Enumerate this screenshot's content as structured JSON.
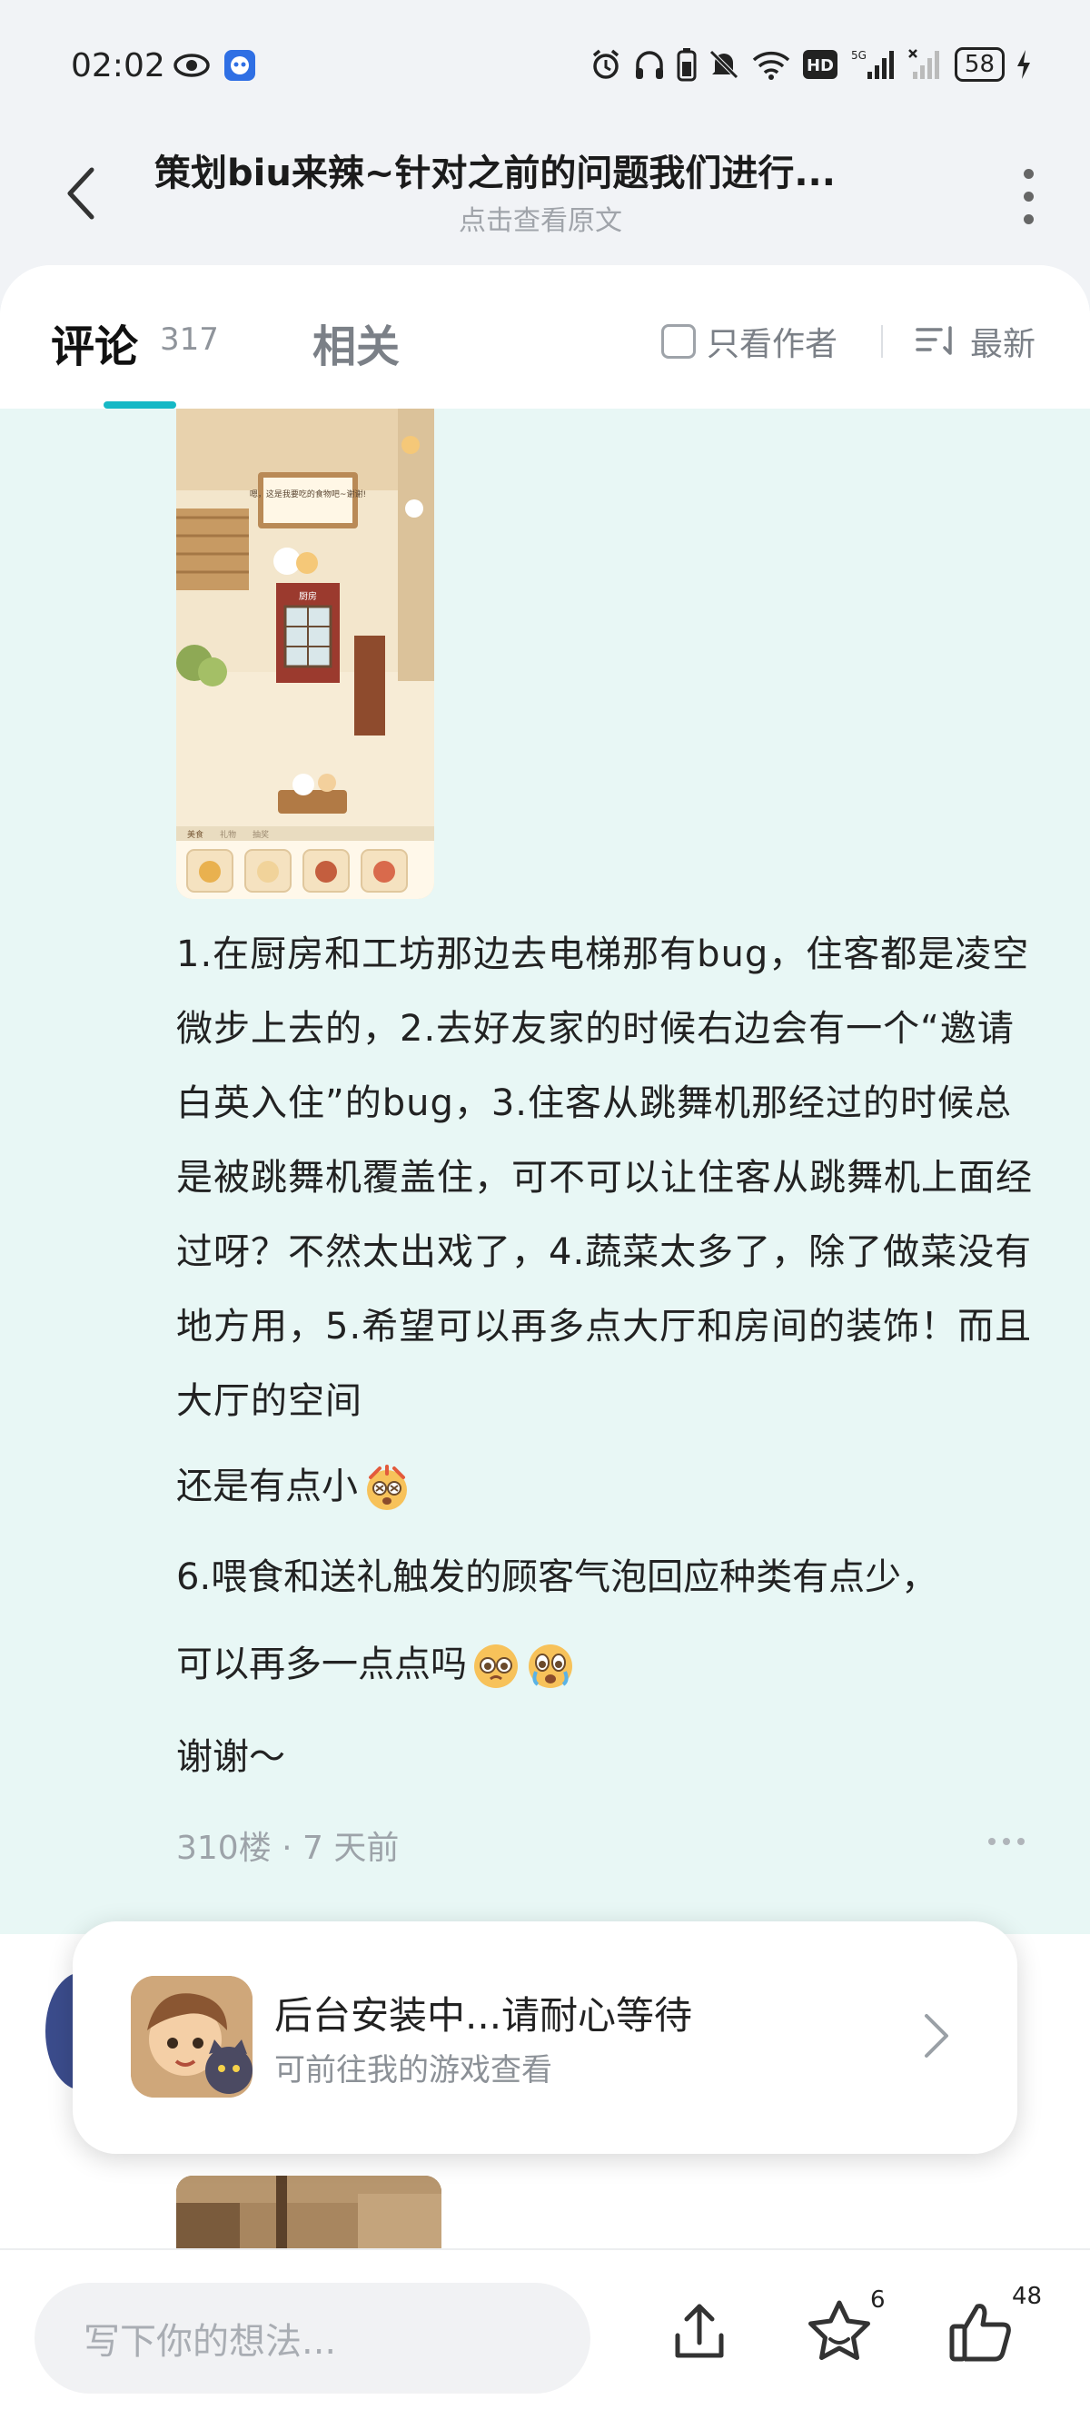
{
  "status_bar": {
    "time": "02:02",
    "battery": "58"
  },
  "header": {
    "title": "策划biu来辣~针对之前的问题我们进行...",
    "subtitle": "点击查看原文"
  },
  "tabs": {
    "comments_label": "评论",
    "comments_count": "317",
    "related_label": "相关",
    "author_only_label": "只看作者",
    "sort_label": "最新"
  },
  "comment": {
    "body": "1.在厨房和工坊那边去电梯那有bug，住客都是凌空微步上去的，2.去好友家的时候右边会有一个“邀请白英入住”的bug，3.住客从跳舞机那经过的时候总是被跳舞机覆盖住，可不可以让住客从跳舞机上面经过呀？不然太出戏了，4.蔬菜太多了，除了做菜没有地方用，5.希望可以再多点大厅和房间的装饰！而且大厅的空间",
    "line_end": "还是有点小",
    "line_6": "6.喂食和送礼触发的顾客气泡回应种类有点少，",
    "line_7": "可以再多一点点吗",
    "line_8": "谢谢～",
    "meta": "310楼 · 7 天前",
    "image_caption": "嗯，这是我要吃的食物吧~谢谢!",
    "image_room_label": "厨房",
    "image_tabs": [
      "美食",
      "礼物",
      "抽奖"
    ]
  },
  "toast": {
    "title": "后台安装中...请耐心等待",
    "subtitle": "可前往我的游戏查看"
  },
  "bottom_bar": {
    "input_placeholder": "写下你的想法...",
    "favorite_count": "6",
    "like_count": "48"
  },
  "colors": {
    "accent": "#16b8c5",
    "highlight_bg": "#e8f7f5",
    "page_bg": "#f1f3f6"
  },
  "icons": [
    "eye-icon",
    "app-notification-icon",
    "alarm-icon",
    "headphones-icon",
    "battery-saver-icon",
    "mute-icon",
    "wifi-icon",
    "hd-icon",
    "signal-icon",
    "battery-icon",
    "back-icon",
    "more-vertical-icon",
    "sort-icon",
    "share-icon",
    "star-icon",
    "thumbs-up-icon",
    "chevron-right-icon"
  ]
}
